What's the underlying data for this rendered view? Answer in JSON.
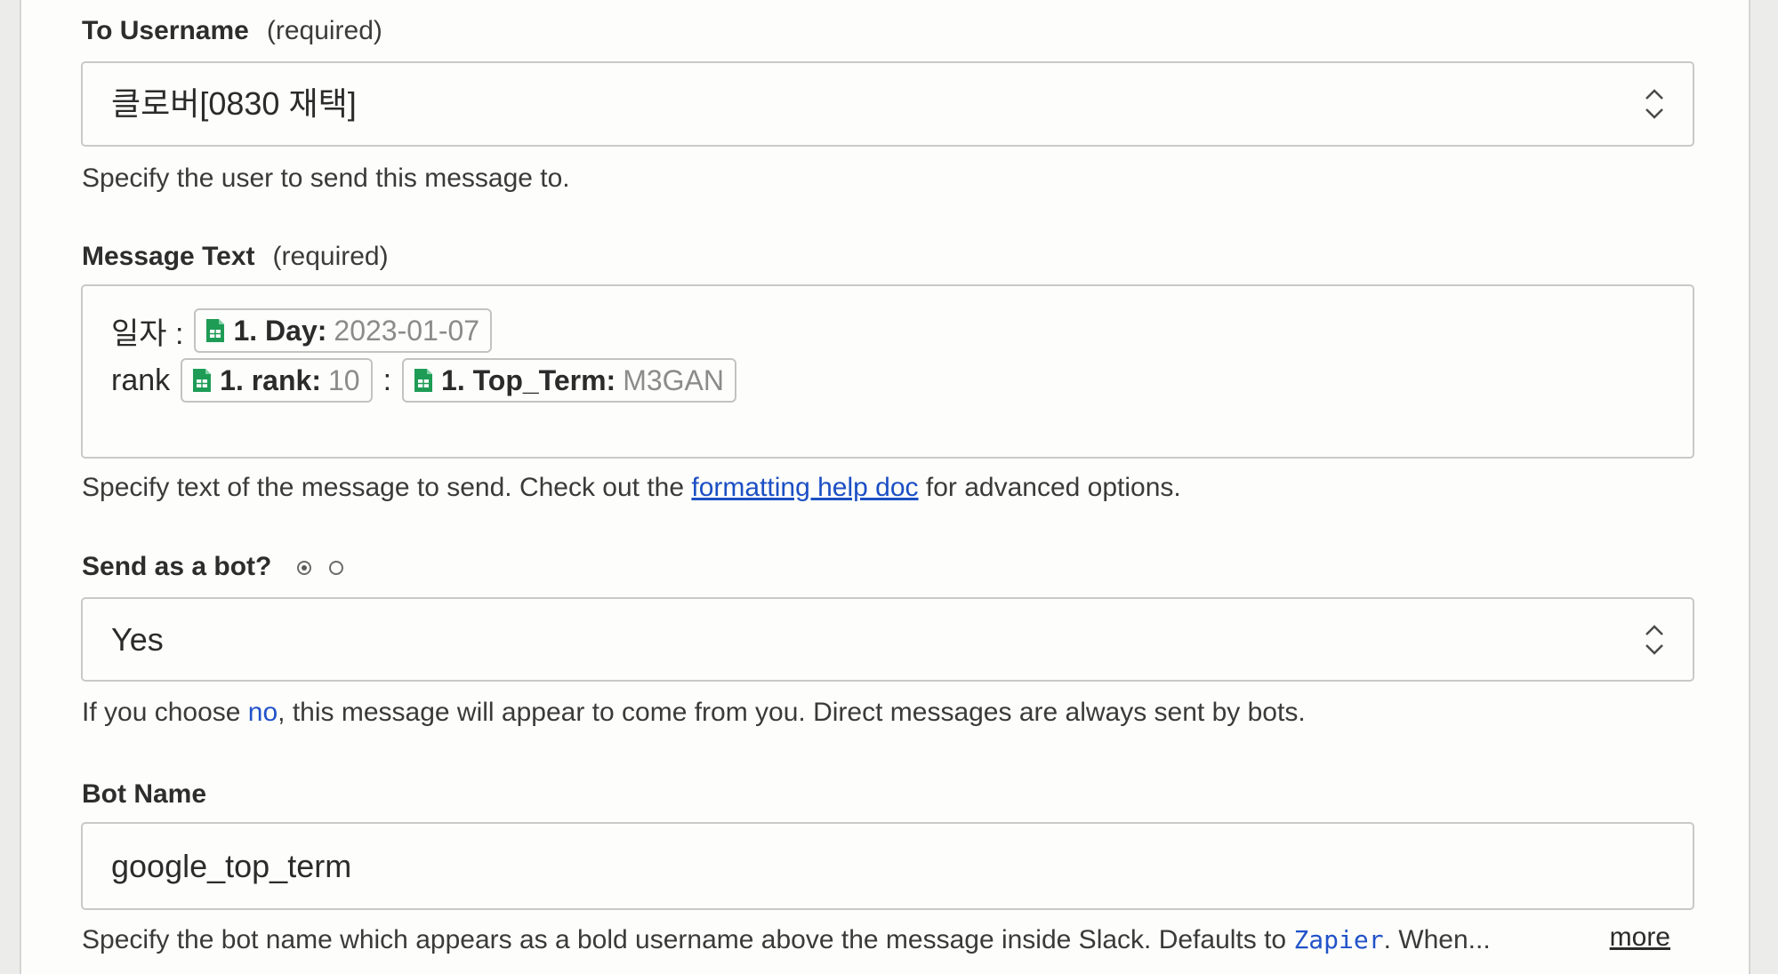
{
  "fields": {
    "to_username": {
      "label": "To Username",
      "required": "(required)",
      "value": "클로버[0830 재택]",
      "help": "Specify the user to send this message to."
    },
    "message_text": {
      "label": "Message Text",
      "required": "(required)",
      "line1_prefix": "일자 :",
      "day_pill": {
        "key": "1. Day:",
        "value": "2023-01-07"
      },
      "line2_prefix": "rank",
      "rank_pill": {
        "key": "1. rank:",
        "value": "10"
      },
      "separator": ":",
      "term_pill": {
        "key": "1. Top_Term:",
        "value": "M3GAN"
      },
      "help_before": "Specify text of the message to send. Check out the ",
      "help_link": "formatting help doc",
      "help_after": " for advanced options."
    },
    "send_as_bot": {
      "label": "Send as a bot?",
      "value": "Yes",
      "help_before": "If you choose ",
      "help_no": "no",
      "help_after": ", this message will appear to come from you. Direct messages are always sent by bots."
    },
    "bot_name": {
      "label": "Bot Name",
      "value": "google_top_term",
      "help_before": "Specify the bot name which appears as a bold username above the message inside Slack. Defaults to ",
      "help_code": "Zapier",
      "help_after": ". When...",
      "more": "more"
    }
  },
  "icons": {
    "pill_icon": "google-sheets-icon",
    "select_icon": "up-down-chevron-icon"
  },
  "colors": {
    "sheets_green": "#1e9c55",
    "link_blue": "#1b4fc4"
  }
}
